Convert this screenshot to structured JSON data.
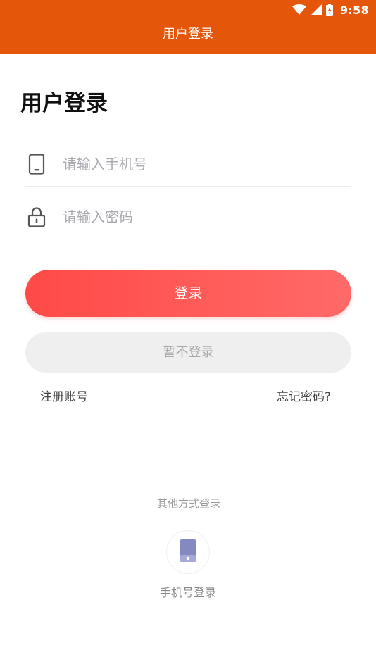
{
  "status_bar": {
    "time": "9:58",
    "icons": [
      "wifi-icon",
      "signal-icon",
      "battery-icon"
    ]
  },
  "header": {
    "title": "用户登录",
    "background": "#e4560a"
  },
  "page": {
    "heading": "用户登录"
  },
  "form": {
    "phone": {
      "placeholder": "请输入手机号",
      "value": "",
      "icon": "phone-icon"
    },
    "password": {
      "placeholder": "请输入密码",
      "value": "",
      "icon": "lock-icon"
    }
  },
  "buttons": {
    "login_label": "登录",
    "login_gradient": [
      "#ff4a47",
      "#ff6a68"
    ],
    "skip_label": "暂不登录"
  },
  "links": {
    "register": "注册账号",
    "forgot": "忘记密码?"
  },
  "alt_login": {
    "divider_text": "其他方式登录",
    "option_label": "手机号登录",
    "option_icon": "mobile-device-icon",
    "icon_color": "#8589c2"
  }
}
